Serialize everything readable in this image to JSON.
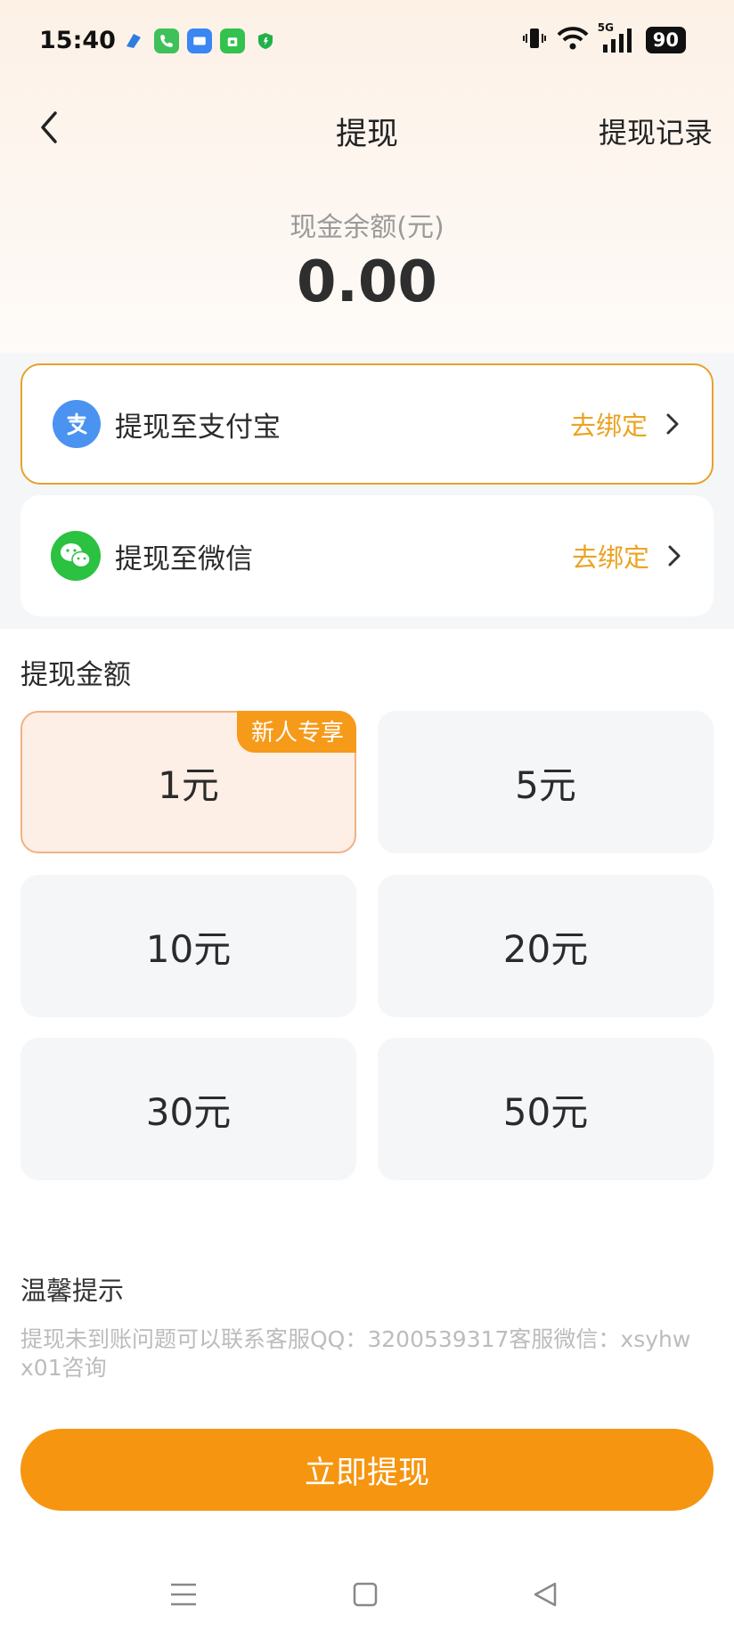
{
  "status_bar": {
    "time": "15:40",
    "network": "5G",
    "battery": "90"
  },
  "nav": {
    "title": "提现",
    "record_link": "提现记录"
  },
  "balance": {
    "label": "现金余额(元)",
    "value": "0.00"
  },
  "methods": [
    {
      "label": "提现至支付宝",
      "action": "去绑定",
      "icon": "alipay-icon",
      "color": "#4a93f0"
    },
    {
      "label": "提现至微信",
      "action": "去绑定",
      "icon": "wechat-icon",
      "color": "#2bc141"
    }
  ],
  "amount_section": {
    "title": "提现金额"
  },
  "amounts": [
    {
      "label": "1元",
      "badge": "新人专享",
      "selected": true
    },
    {
      "label": "5元"
    },
    {
      "label": "10元"
    },
    {
      "label": "20元"
    },
    {
      "label": "30元"
    },
    {
      "label": "50元"
    }
  ],
  "tips": {
    "title": "温馨提示",
    "text": "提现未到账问题可以联系客服QQ：3200539317客服微信：xsyhwx01咨询"
  },
  "submit_label": "立即提现",
  "colors": {
    "accent": "#f6950f",
    "action_text": "#eba323",
    "selected_bg": "#fdeee6"
  }
}
